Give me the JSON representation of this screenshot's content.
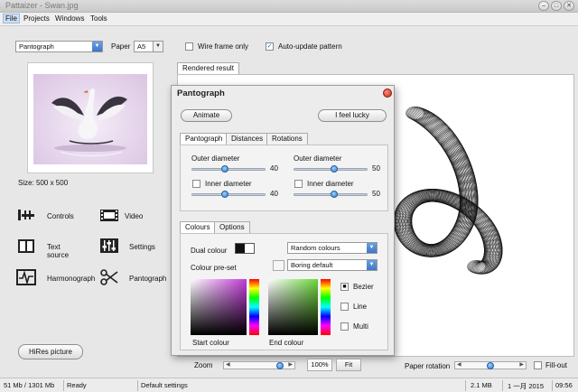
{
  "window": {
    "title": "Pattaizer - Swan.jpg",
    "minimize_glyph": "–",
    "maximize_glyph": "□",
    "close_glyph": "✕"
  },
  "menu": [
    "File",
    "Projects",
    "Windows",
    "Tools"
  ],
  "toolbar": {
    "mode_value": "Pantograph",
    "paper_label": "Paper",
    "paper_value": "A5",
    "wireframe_label": "Wire frame only",
    "wireframe_checked": false,
    "autoupdate_label": "Auto-update pattern",
    "autoupdate_checked": true
  },
  "preview": {
    "size_label": "Size: 500 x 500"
  },
  "sidebar": [
    {
      "label": "Controls",
      "icon": "controls-icon"
    },
    {
      "label": "Video",
      "icon": "film-icon"
    },
    {
      "label": "Text source",
      "icon": "book-icon"
    },
    {
      "label": "Settings",
      "icon": "sliders-icon"
    },
    {
      "label": "Harmonograph",
      "icon": "waveform-icon"
    },
    {
      "label": "Pantograph",
      "icon": "scissors-icon"
    }
  ],
  "hires_button": "HiRes picture",
  "result_tab": "Rendered result",
  "dialog": {
    "title": "Pantograph",
    "animate": "Animate",
    "lucky": "I feel lucky",
    "tabs": [
      "Pantograph",
      "Distances",
      "Rotations"
    ],
    "outer1_label": "Outer diameter",
    "outer1_value": "40",
    "outer1_level": 0.45,
    "inner1_label": "Inner diameter",
    "inner1_value": "40",
    "inner1_level": 0.45,
    "outer2_label": "Outer diameter",
    "outer2_value": "50",
    "outer2_level": 0.55,
    "inner2_label": "Inner diameter",
    "inner2_value": "50",
    "inner2_level": 0.55,
    "colour_tabs": [
      "Colours",
      "Options"
    ],
    "dual_colour_label": "Dual colour",
    "random_colours": "Random colours",
    "preset_label": "Colour pre-set",
    "preset_value": "Boring default",
    "start_colour": "Start colour",
    "end_colour": "End colour",
    "bezier": "Bezier",
    "line": "Line",
    "multi": "Multi"
  },
  "bottom": {
    "zoom_label": "Zoom",
    "zoom_value": "100%",
    "fit": "Fit",
    "paper_rotation": "Paper rotation",
    "fill_out": "Fill-out"
  },
  "status": {
    "memory": "51 Mb / 1301 Mb",
    "ready": "Ready",
    "settings": "Default settings",
    "size": "2.1 MB",
    "date": "1 一月 2015",
    "time": "09:56"
  },
  "colors": {
    "accent": "#3d77c8",
    "dialog_close": "#d23a2a"
  }
}
